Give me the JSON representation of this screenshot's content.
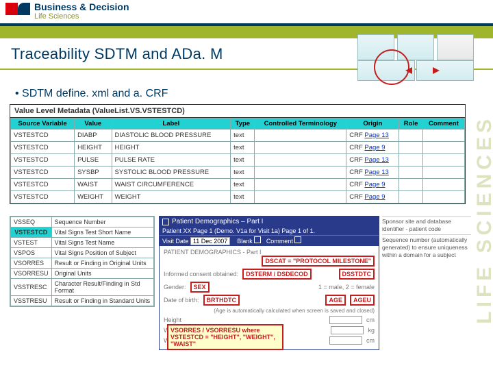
{
  "logo": {
    "brand": "Business & Decision",
    "tagline": "Life Sciences"
  },
  "side_brand": "LIFE SCIENCES",
  "title": "Traceability SDTM and ADa. M",
  "bullet": "SDTM define. xml and a. CRF",
  "vlm": {
    "caption": "Value Level Metadata (ValueList.VS.VSTESTCD)",
    "headers": [
      "Source Variable",
      "Value",
      "Label",
      "Type",
      "Controlled Terminology",
      "Origin",
      "Role",
      "Comment"
    ],
    "rows": [
      {
        "src": "VSTESTCD",
        "val": "DIABP",
        "label": "DIASTOLIC BLOOD PRESSURE",
        "type": "text",
        "ct": "",
        "origin_pre": "CRF ",
        "origin_link": "Page 13",
        "role": "",
        "comment": ""
      },
      {
        "src": "VSTESTCD",
        "val": "HEIGHT",
        "label": "HEIGHT",
        "type": "text",
        "ct": "",
        "origin_pre": "CRF ",
        "origin_link": "Page 9",
        "role": "",
        "comment": ""
      },
      {
        "src": "VSTESTCD",
        "val": "PULSE",
        "label": "PULSE RATE",
        "type": "text",
        "ct": "",
        "origin_pre": "CRF ",
        "origin_link": "Page 13",
        "role": "",
        "comment": ""
      },
      {
        "src": "VSTESTCD",
        "val": "SYSBP",
        "label": "SYSTOLIC BLOOD PRESSURE",
        "type": "text",
        "ct": "",
        "origin_pre": "CRF ",
        "origin_link": "Page 13",
        "role": "",
        "comment": ""
      },
      {
        "src": "VSTESTCD",
        "val": "WAIST",
        "label": "WAIST CIRCUMFERENCE",
        "type": "text",
        "ct": "",
        "origin_pre": "CRF ",
        "origin_link": "Page 9",
        "role": "",
        "comment": ""
      },
      {
        "src": "VSTESTCD",
        "val": "WEIGHT",
        "label": "WEIGHT",
        "type": "text",
        "ct": "",
        "origin_pre": "CRF ",
        "origin_link": "Page 9",
        "role": "",
        "comment": ""
      }
    ]
  },
  "vars": {
    "rows": [
      {
        "a": "VSSEQ",
        "b": "Sequence Number"
      },
      {
        "a": "VSTESTCD",
        "b": "Vital Signs Test Short Name"
      },
      {
        "a": "VSTEST",
        "b": "Vital Signs Test Name"
      },
      {
        "a": "VSPOS",
        "b": "Vital Signs Position of Subject"
      },
      {
        "a": "VSORRES",
        "b": "Result or Finding in Original Units"
      },
      {
        "a": "VSORRESU",
        "b": "Original Units"
      },
      {
        "a": "VSSTRESC",
        "b": "Character Result/Finding in Std Format"
      },
      {
        "a": "VSSTRESU",
        "b": "Result or Finding in Standard Units"
      }
    ]
  },
  "crf": {
    "bar": "Patient Demographics – Part I",
    "line2": "Patient XX  Page 1 (Demo. V1a for Visit 1a)  Page 1 of 1.",
    "visit_label": "Visit Date",
    "visit_value": "11 Dec 2007",
    "blank_label": "Blank",
    "comment_label": "Comment",
    "heading": "PATIENT DEMOGRAPHICS - Part I",
    "annot_dscat": "DSCAT = \"PROTOCOL MILESTONE\"",
    "row_consent_label": "Informed consent obtained:",
    "row_consent_box": "DSTERM / DSDECOD",
    "row_dsstdtc": "DSSTDTC",
    "row_gender_label": "Gender:",
    "row_gender_box": "SEX",
    "row_gender_codes": "1 = male, 2 = female",
    "row_dob_label": "Date of birth:",
    "row_dob_box": "BRTHDTC",
    "row_age_box": "AGE",
    "row_ageu_box": "AGEU",
    "row_age_note": "(Age is automatically calculated when screen is saved and closed)",
    "vs_rows": [
      {
        "l": "Height",
        "u": "cm"
      },
      {
        "l": "Weight",
        "u": "kg"
      },
      {
        "l": "Waist circumference",
        "u": "cm"
      }
    ]
  },
  "meta": {
    "a": "Sponsor site and database identifier - patient code",
    "b": "Sequence number (automatically generated) to ensure uniqueness within a domain for a subject"
  },
  "notes": {
    "right": "",
    "bottom": "VSORRES / VSORRESU where VSTESTCD = \"HEIGHT\", \"WEIGHT\", \"WAIST\""
  }
}
